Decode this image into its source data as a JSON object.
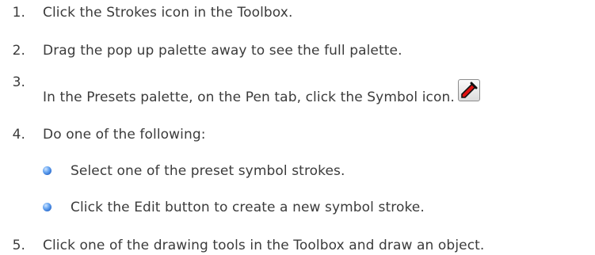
{
  "steps": [
    {
      "number": "1.",
      "text": "Click the Strokes icon in the Toolbox."
    },
    {
      "number": "2.",
      "text": "Drag the pop up palette away to see the full palette."
    },
    {
      "number": "3.",
      "text": "In the Presets palette, on the Pen tab, click the Symbol icon.",
      "icon": "symbol-icon"
    },
    {
      "number": "4.",
      "text": "Do one of the following:"
    },
    {
      "number": "5.",
      "text": "Click one of the drawing tools in the Toolbox and draw an object."
    }
  ],
  "sub_bullets": [
    {
      "text": "Select one of the preset symbol strokes."
    },
    {
      "text": "Click the Edit button to create a new symbol stroke."
    }
  ],
  "colors": {
    "text": "#3b3b3b",
    "bullet": "#2f6fd0",
    "icon_stroke": "#e01010"
  }
}
